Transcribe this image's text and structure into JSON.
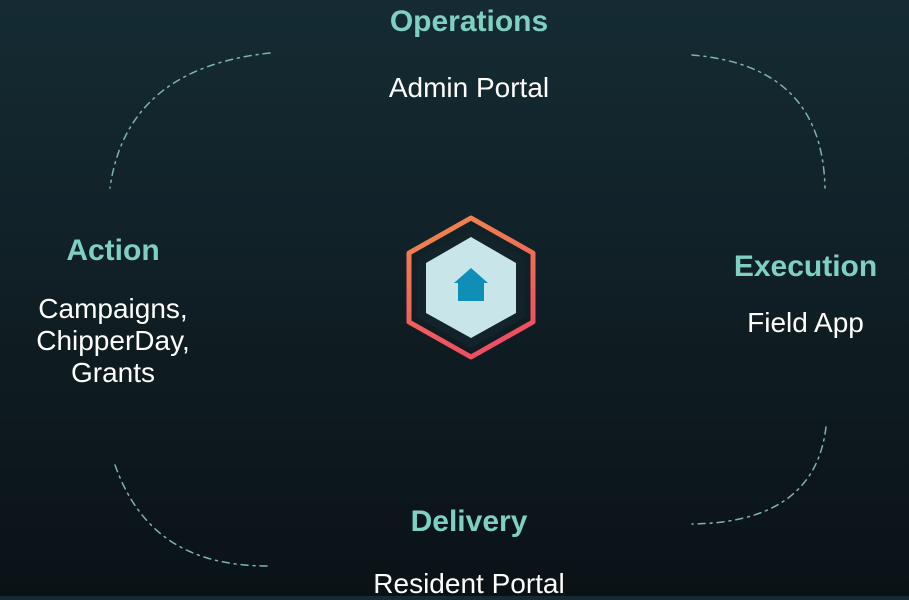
{
  "colors": {
    "background_top": "#152b33",
    "background_bottom": "#0a1216",
    "title": "#7fd0c2",
    "body_text": "#ffffff",
    "connector": "#7fb3ad",
    "hub_gradient_start": "#f08a4b",
    "hub_gradient_end": "#ef4f62",
    "hub_inner_fill": "#c8e6ea",
    "hub_dark_fill": "#12232a",
    "hub_icon": "#0f8fb7"
  },
  "hub": {
    "icon": "house-icon"
  },
  "nodes": {
    "operations": {
      "title": "Operations",
      "body": "Admin Portal"
    },
    "action": {
      "title": "Action",
      "body": "Campaigns,\nChipperDay,\nGrants"
    },
    "execution": {
      "title": "Execution",
      "body": "Field App"
    },
    "delivery": {
      "title": "Delivery",
      "body": "Resident Portal"
    }
  }
}
